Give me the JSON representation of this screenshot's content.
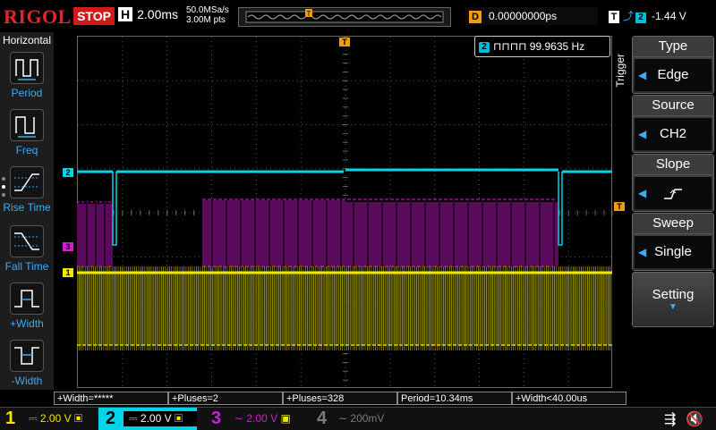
{
  "top": {
    "logo": "RIGOL",
    "run_state": "STOP",
    "h_label": "H",
    "timebase": "2.00ms",
    "sample_rate": "50.0MSa/s",
    "mem_depth": "3.00M pts",
    "delay_label": "D",
    "delay_value": "0.00000000ps",
    "trig_label": "T",
    "trig_channel": "2",
    "trig_level": "-1.44 V"
  },
  "left_panel": {
    "title": "Horizontal",
    "items": [
      {
        "label": "Period"
      },
      {
        "label": "Freq"
      },
      {
        "label": "Rise Time"
      },
      {
        "label": "Fall Time"
      },
      {
        "label": "+Width"
      },
      {
        "label": "-Width"
      }
    ]
  },
  "freq_readout": {
    "channel": "2",
    "value": "99.9635 Hz"
  },
  "right_panel": {
    "trigger_label": "Trigger",
    "type": {
      "title": "Type",
      "value": "Edge"
    },
    "source": {
      "title": "Source",
      "value": "CH2"
    },
    "slope": {
      "title": "Slope"
    },
    "sweep": {
      "title": "Sweep",
      "value": "Single"
    },
    "setting": {
      "title": "Setting"
    }
  },
  "measurements": [
    "+Width=*****",
    "+Pluses=2",
    "+Pluses=328",
    "Period=10.34ms",
    "+Width<40.00us"
  ],
  "channels": [
    {
      "num": "1",
      "value": "2.00 V",
      "color": "#f2e600"
    },
    {
      "num": "2",
      "value": "2.00 V",
      "color": "#00d4e8"
    },
    {
      "num": "3",
      "value": "2.00 V",
      "color": "#d81bd8"
    },
    {
      "num": "4",
      "value": "200mV",
      "color": "#7a7a7a"
    }
  ],
  "trace_markers": {
    "ch1": "1",
    "ch2": "2",
    "ch3": "3",
    "trigger": "T"
  },
  "colors": {
    "ch1": "#f2e600",
    "ch2": "#00d4e8",
    "ch3": "#d81bd8",
    "accent_blue": "#3fa9f5",
    "stop_red": "#d11a1a",
    "orange": "#f39c12"
  }
}
